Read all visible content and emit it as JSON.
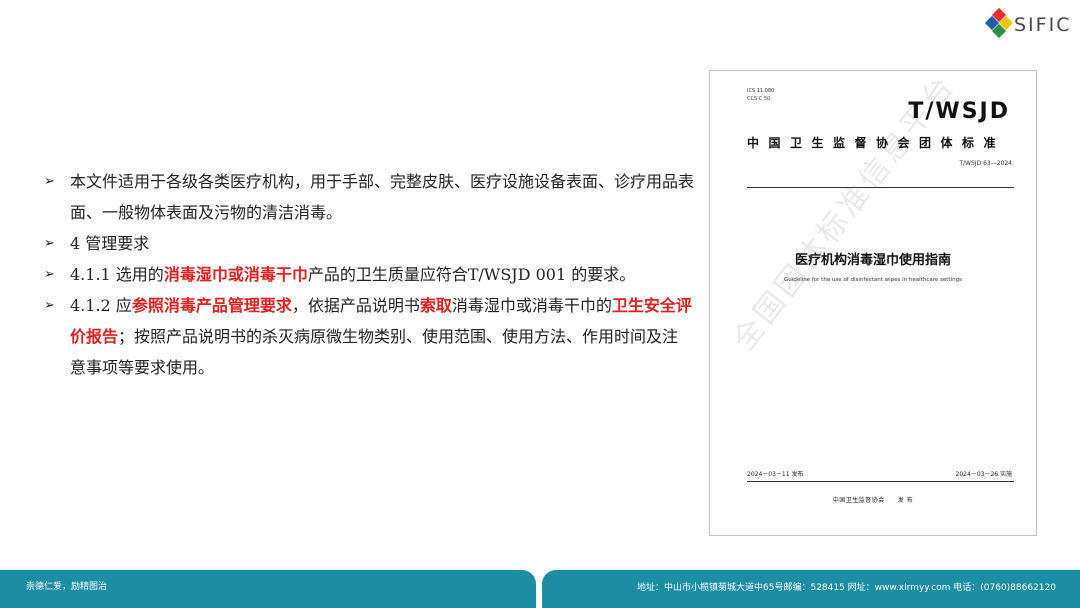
{
  "logo": {
    "text": "SIFIC",
    "colors": [
      "#e8312f",
      "#1f5fae",
      "#f5c400",
      "#2f8e45"
    ]
  },
  "bullets": [
    [
      {
        "t": "本文件适用于各级各类医疗机构，用于手部、完整皮肤、医疗设施设备表面、诊疗用品表面、一般物体表面及污物的清洁消毒。",
        "hl": false
      }
    ],
    [
      {
        "t": "4 管理要求",
        "hl": false
      }
    ],
    [
      {
        "t": "4.1.1 选用的",
        "hl": false
      },
      {
        "t": "消毒湿巾或消毒干巾",
        "hl": true
      },
      {
        "t": "产品的卫生质量应符合T/WSJD 001 的要求。",
        "hl": false
      }
    ],
    [
      {
        "t": "4.1.2 应",
        "hl": false
      },
      {
        "t": "参照消毒产品管理要求",
        "hl": true
      },
      {
        "t": "，依据产品说明书",
        "hl": false
      },
      {
        "t": "索取",
        "hl": true
      },
      {
        "t": "消毒湿巾或消毒干巾的",
        "hl": false
      },
      {
        "t": "卫生安全评价报告",
        "hl": true
      },
      {
        "t": "；按照产品说明书的杀灭病原微生物类别、使用范围、使用方法、作用时间及注意事项等要求使用。",
        "hl": false
      }
    ]
  ],
  "cover": {
    "ics": "ICS 11.080",
    "ccs": "CCS C 50",
    "standard": "T/WSJD",
    "association": "中国卫生监督协会团体标准",
    "number": "T/WSJD 63—2024",
    "title_cn": "医疗机构消毒湿巾使用指南",
    "title_en": "Guideline for the use of disinfectant wipes in healthcare settings",
    "published": "2024－03－11 发布",
    "implemented": "2024－03－26 实施",
    "issuer": "中国卫生监督协会　　发 布",
    "watermark": "全国团体标准信息平台"
  },
  "footer": {
    "slogan": "崇德仁爱，励精图治",
    "address": "地址：中山市小榄镇菊城大道中65号邮编：528415 网址：www.xlrmyy.com 电话：(0760)88662120"
  }
}
